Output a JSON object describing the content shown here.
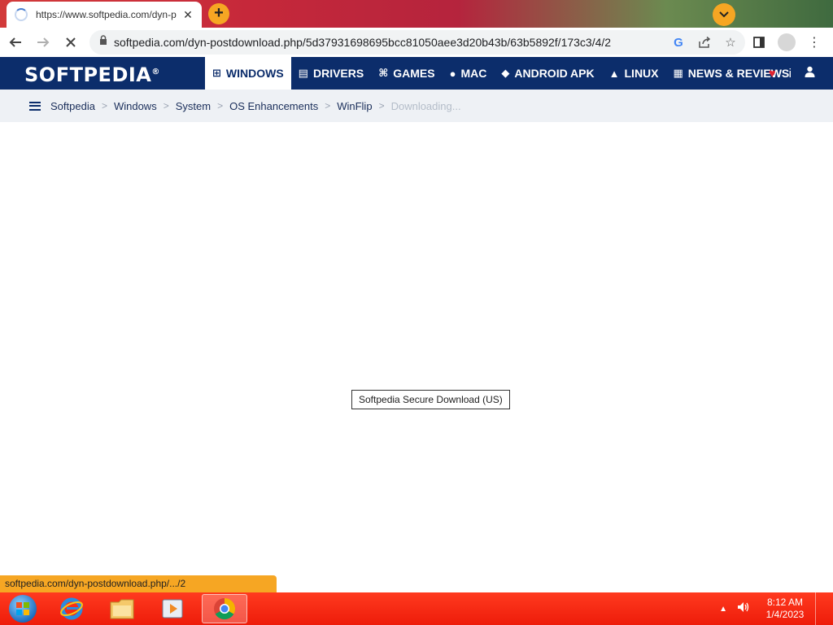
{
  "browser": {
    "tab_title": "https://www.softpedia.com/dyn-p",
    "url": "softpedia.com/dyn-postdownload.php/5d37931698695bcc81050aee3d20b43b/63b5892f/173c3/4/2",
    "status_url": "softpedia.com/dyn-postdownload.php/.../2",
    "accent": "#f6a623"
  },
  "site": {
    "logo": "SOFTPEDIA",
    "logo_mark": "®",
    "nav": [
      {
        "label": "WINDOWS",
        "icon": "windows-icon"
      },
      {
        "label": "DRIVERS",
        "icon": "drivers-icon"
      },
      {
        "label": "GAMES",
        "icon": "gamepad-icon"
      },
      {
        "label": "MAC",
        "icon": "apple-icon"
      },
      {
        "label": "ANDROID APK",
        "icon": "android-icon"
      },
      {
        "label": "LINUX",
        "icon": "linux-icon"
      },
      {
        "label": "NEWS & REVIEWS",
        "icon": "news-icon"
      }
    ],
    "header_color": "#0c2d6b"
  },
  "breadcrumb": [
    "Softpedia",
    "Windows",
    "System",
    "OS Enhancements",
    "WinFlip",
    "Downloading..."
  ],
  "main": {
    "download_label": "Softpedia Secure Download (US)"
  },
  "taskbar": {
    "time": "8:12 AM",
    "date": "1/4/2023",
    "color": "#ee1c0a"
  }
}
